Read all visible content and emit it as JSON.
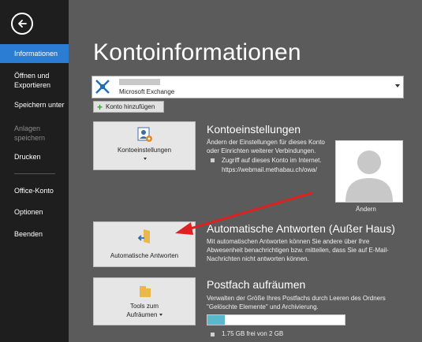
{
  "sidebar": {
    "items": [
      {
        "label": "Informationen"
      },
      {
        "label": "Öffnen und Exportieren"
      },
      {
        "label": "Speichern unter"
      },
      {
        "label": "Anlagen speichern"
      },
      {
        "label": "Drucken"
      },
      {
        "label": "Office-Konto"
      },
      {
        "label": "Optionen"
      },
      {
        "label": "Beenden"
      }
    ]
  },
  "page": {
    "title": "Kontoinformationen"
  },
  "account": {
    "type": "Microsoft Exchange"
  },
  "add_account": {
    "label": "Konto hinzufügen"
  },
  "settings": {
    "button_label": "Kontoeinstellungen",
    "title": "Kontoeinstellungen",
    "desc_line1": "Ändern der Einstellungen für dieses Konto",
    "desc_line2": "oder Einrichten weiterer Verbindungen.",
    "bullet_line1": "Zugriff auf dieses Konto im Internet.",
    "bullet_line2": "https://webmail.methabau.ch/owa/"
  },
  "avatar": {
    "change_label": "Ändern"
  },
  "auto_reply": {
    "button_label": "Automatische Antworten",
    "title": "Automatische Antworten (Außer Haus)",
    "desc_line1": "Mit automatischen Antworten können Sie andere über Ihre",
    "desc_line2": "Abwesenheit benachrichtigen bzw. mitteilen, dass Sie auf E-Mail-",
    "desc_line3": "Nachrichten nicht antworten können."
  },
  "mailbox": {
    "button_line1": "Tools zum",
    "button_line2": "Aufräumen",
    "title": "Postfach aufräumen",
    "desc_line1": "Verwalten der Größe Ihres Postfachs durch Leeren des Ordners",
    "desc_line2": "\"Gelöschte Elemente\" und Archivierung.",
    "usage_fraction": 0.125,
    "usage_text": "1.75 GB frei von 2 GB"
  },
  "colors": {
    "accent": "#2b7cd3",
    "sidebar": "#1e1e1e",
    "background": "#5b5b5b",
    "arrow": "#e02020",
    "storage": "#58b8cc"
  }
}
